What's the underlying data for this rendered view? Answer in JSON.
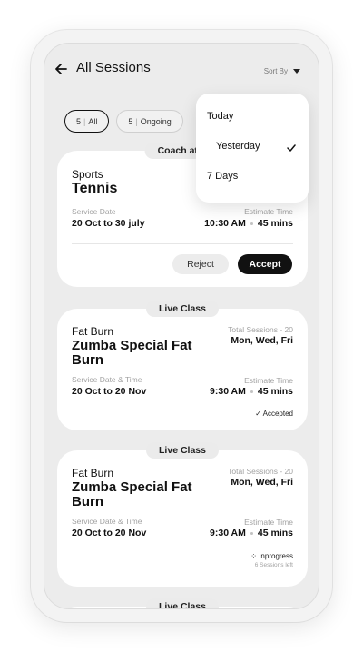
{
  "header": {
    "title": "All Sessions",
    "sort_label": "Sort By"
  },
  "filters": [
    {
      "count": "5",
      "label": "All",
      "active": true
    },
    {
      "count": "5",
      "label": "Ongoing",
      "active": false
    }
  ],
  "sort_menu": {
    "options": [
      "Today",
      "Yesterday",
      "7 Days"
    ],
    "selected": "Yesterday"
  },
  "sessions": [
    {
      "tag": "Coach at H",
      "category": "Sports",
      "name": "Tennis",
      "date_label": "Service Date",
      "date_value": "20 Oct to 30 july",
      "time_label": "Estimate Time",
      "time_value": "10:30 AM",
      "duration": "45 mins",
      "reject_label": "Reject",
      "accept_label": "Accept"
    },
    {
      "tag": "Live Class",
      "category": "Fat Burn",
      "name_line1": "Zumba Special Fat",
      "name_line2": "Burn",
      "total_sessions": "Total Sessions - 20",
      "days": "Mon, Wed, Fri",
      "date_label": "Service Date & Time",
      "date_value": "20 Oct to 20 Nov",
      "time_label": "Estimate Time",
      "time_value": "9:30 AM",
      "duration": "45 mins",
      "status": "Accepted"
    },
    {
      "tag": "Live Class",
      "category": "Fat Burn",
      "name_line1": "Zumba Special Fat",
      "name_line2": "Burn",
      "total_sessions": "Total Sessions - 20",
      "days": "Mon, Wed, Fri",
      "date_label": "Service Date & Time",
      "date_value": "20 Oct to 20 Nov",
      "time_label": "Estimate Time",
      "time_value": "9:30 AM",
      "duration": "45 mins",
      "status": "Inprogress",
      "status_sub": "6 Sessions left"
    },
    {
      "tag": "Live Class"
    }
  ],
  "icons": {
    "back": "arrow-left-icon",
    "sort": "caret-down-icon",
    "check": "check-icon",
    "spinner": "spinner-icon"
  }
}
